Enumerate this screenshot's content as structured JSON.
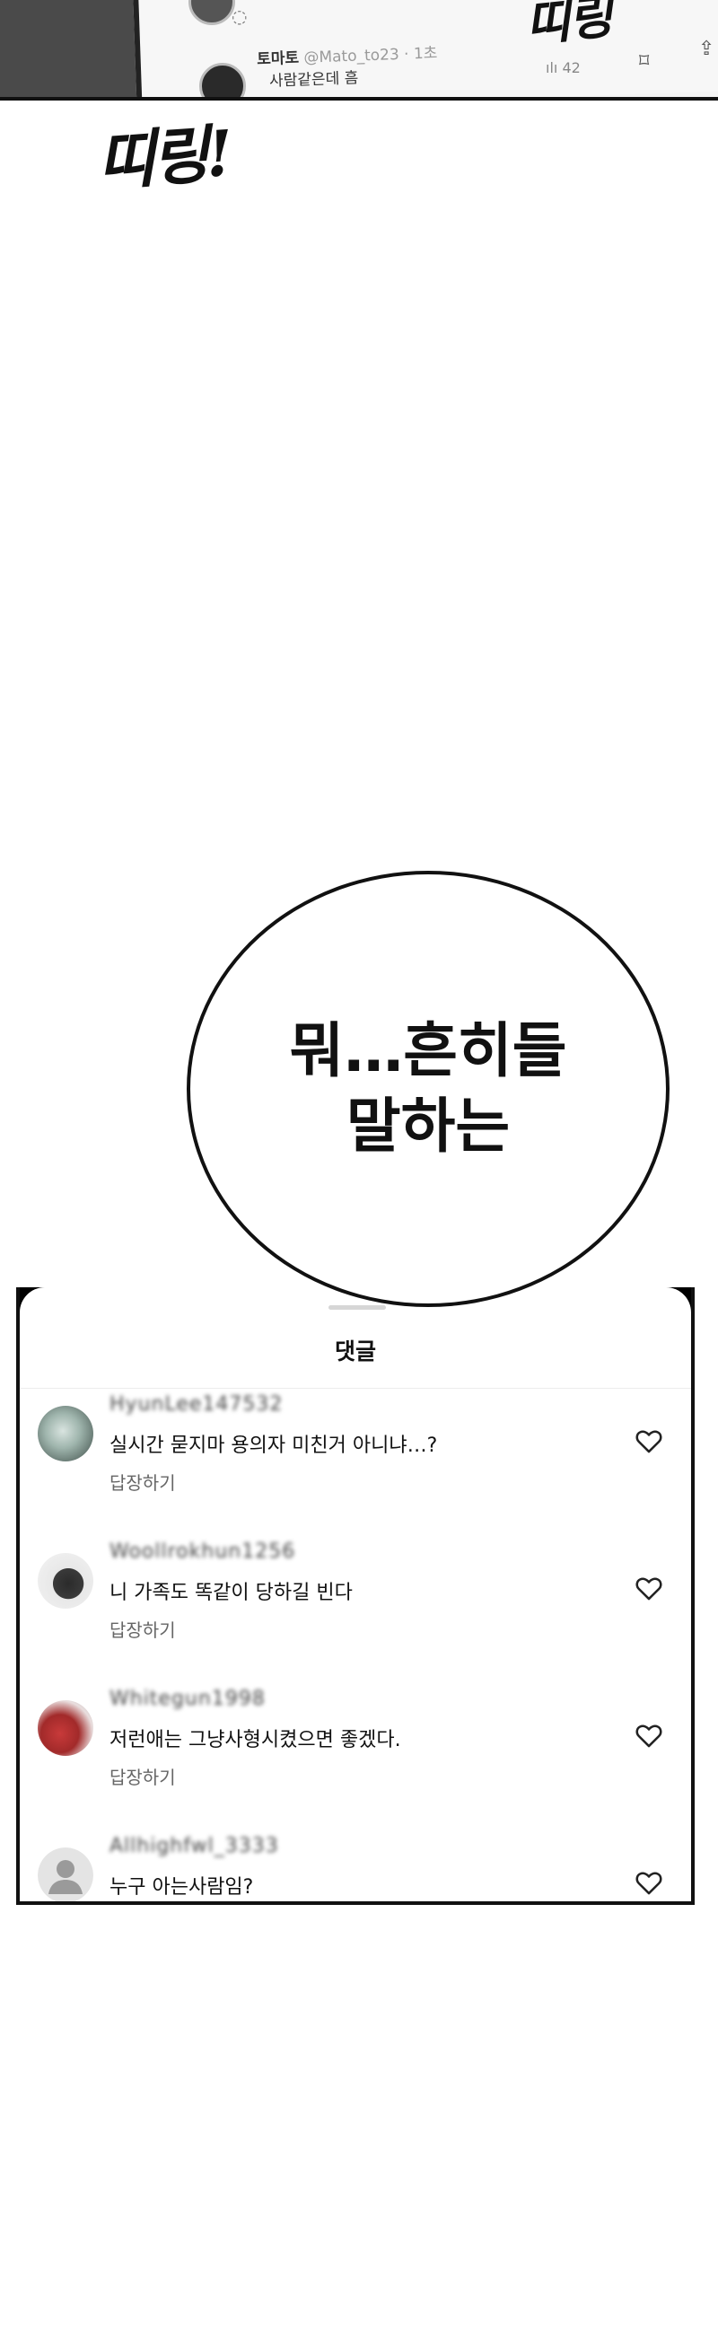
{
  "top_strip": {
    "user_name": "토마토",
    "user_handle": "@Mato_to23 · 1초",
    "tweet_text": "사람같은데 흠",
    "views": "42"
  },
  "sfx": {
    "top": "띠링",
    "main": "띠링!"
  },
  "bubble": {
    "lines": [
      "뭐…흔히들",
      "말하는"
    ]
  },
  "comments_sheet": {
    "title": "댓글",
    "reply_label": "답장하기",
    "comments": [
      {
        "user": "HyunLee147532",
        "text": "실시간 묻지마 용의자 미친거 아니냐…?",
        "reply": "답장하기"
      },
      {
        "user": "Woollrokhun1256",
        "text": "니 가족도 똑같이 당하길 빈다",
        "reply": "답장하기"
      },
      {
        "user": "Whitegun1998",
        "text": "저런애는 그냥사형시켰으면 좋겠다.",
        "reply": "답장하기"
      },
      {
        "user": "Allhighfwl_3333",
        "text": "누구 아는사람임?",
        "reply": ""
      }
    ]
  },
  "colors": {
    "ink": "#111111",
    "muted": "#666666",
    "divider": "#ececec"
  }
}
